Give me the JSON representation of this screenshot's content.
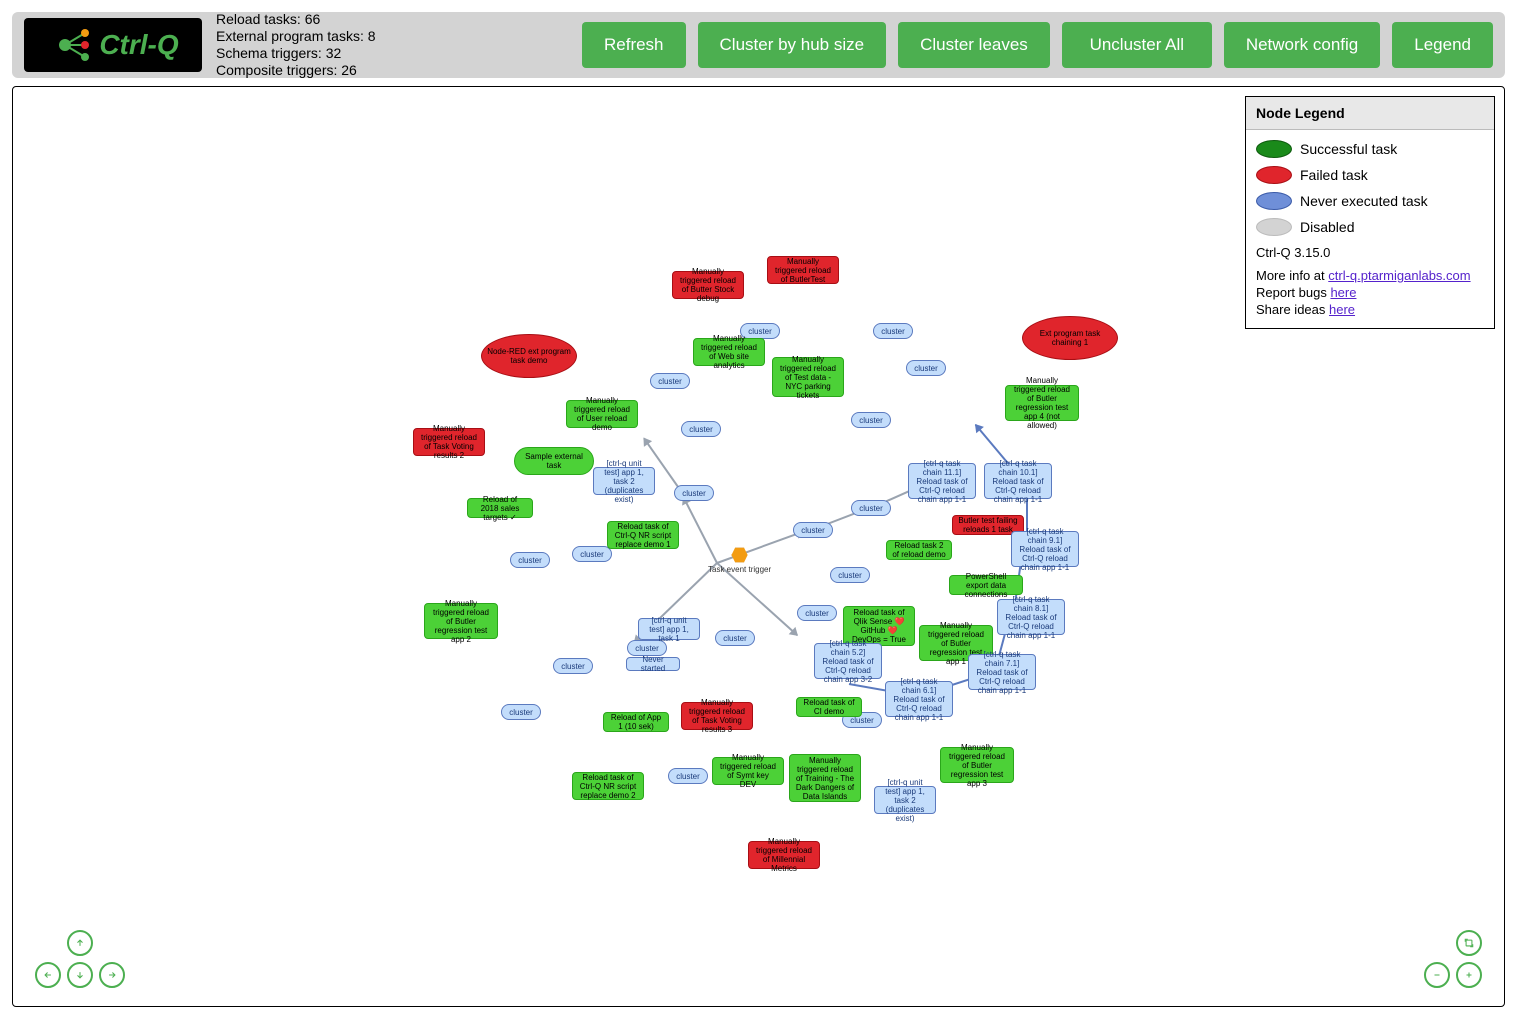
{
  "app": {
    "logo_text": "Ctrl-Q"
  },
  "stats": {
    "reload_tasks": "Reload tasks: 66",
    "ext_prog_tasks": "External program tasks: 8",
    "schema_triggers": "Schema triggers: 32",
    "composite_triggers": "Composite triggers: 26"
  },
  "toolbar": {
    "refresh": "Refresh",
    "cluster_hub": "Cluster by hub size",
    "cluster_leaves": "Cluster leaves",
    "uncluster_all": "Uncluster All",
    "network_config": "Network config",
    "legend": "Legend"
  },
  "legend": {
    "title": "Node Legend",
    "successful": "Successful task",
    "failed": "Failed task",
    "never": "Never executed task",
    "disabled": "Disabled",
    "version": "Ctrl-Q 3.15.0",
    "more_info_prefix": "More info at ",
    "more_info_link": "ctrl-q.ptarmiganlabs.com",
    "report_bugs_prefix": "Report bugs ",
    "report_bugs_link": "here",
    "share_ideas_prefix": "Share ideas ",
    "share_ideas_link": "here"
  },
  "hex_label": "Task event trigger",
  "cluster_label": "cluster",
  "nodes": {
    "n_never_started": "Never started",
    "n_sample_external": "Sample external task",
    "n_training_dark": "Manually triggered reload of Training - The Dark Dangers of Data Islands",
    "n_symt_key": "Manually triggered reload of Symt key DEV",
    "n_nr_replace2": "Reload task of Ctrl-Q NR script replace demo 2",
    "n_nr_replace1": "Reload task of Ctrl-Q NR script replace demo 1",
    "n_app1_10s": "Reload of App 1 (10 sek)",
    "n_ci_demo": "Reload task of CI demo",
    "n_2018_sales": "Reload of 2018 sales targets ✓",
    "n_user_reload": "Manually triggered reload of User reload demo",
    "n_web_analytics": "Manually triggered reload of Web site analytics",
    "n_nyc_tickets": "Manually triggered reload of Test data - NYC parking tickets",
    "n_butler4": "Manually triggered reload of Butler regression test app 4 (not allowed)",
    "n_butler1": "Manually triggered reload of Butler regression test app 1",
    "n_butler2": "Manually triggered reload of Butler regression test app 2",
    "n_butler3": "Manually triggered reload of Butler regression test app 3",
    "n_reload_task2": "Reload task 2 of reload demo",
    "n_ps_export": "PowerShell export data connections",
    "n_qs_github": "Reload task of Qlik Sense ❤️ GitHub ❤️ DevOps = True",
    "n_chain_5_2": "[ctrl-q task chain 5.2] Reload task of Ctrl-Q reload chain app 3-2",
    "n_chain_6_1": "[ctrl-q task chain 6.1] Reload task of Ctrl-Q reload chain app 1-1",
    "n_chain_7_1": "[ctrl-q task chain 7.1] Reload task of Ctrl-Q reload chain app 1-1",
    "n_chain_8_1": "[ctrl-q task chain 8.1] Reload task of Ctrl-Q reload chain app 1-1",
    "n_chain_9_1": "[ctrl-q task chain 9.1] Reload task of Ctrl-Q reload chain app 1-1",
    "n_chain_10_1": "[ctrl-q task chain 10.1] Reload task of Ctrl-Q reload chain app 1-1",
    "n_chain_11_1": "[ctrl-q task chain 11.1] Reload task of Ctrl-Q reload chain app 1-1",
    "n_unit_a1t1": "[ctrl-q unit test] app 1, task 1",
    "n_unit_a1t2a": "[ctrl-q unit test] app 1, task 2 (duplicates exist)",
    "n_unit_a1t2b": "[ctrl-q unit test] app 1, task 2 (duplicates exist)",
    "n_red_nodered": "Node-RED ext program task demo",
    "n_red_butlertest": "Manually triggered reload of ButlerTest",
    "n_red_butter_stock": "Manually triggered reload of Butter Stock debug",
    "n_red_task_voting2": "Manually triggered reload of Task Voting results 2",
    "n_red_task_voting3": "Manually triggered reload of Task Voting results 3",
    "n_red_millennial": "Manually triggered reload of Millennial Metrics",
    "n_red_ext_prog": "Ext program task chaining 1",
    "n_red_butler_failing": "Butler test failing reloads 1 task"
  }
}
